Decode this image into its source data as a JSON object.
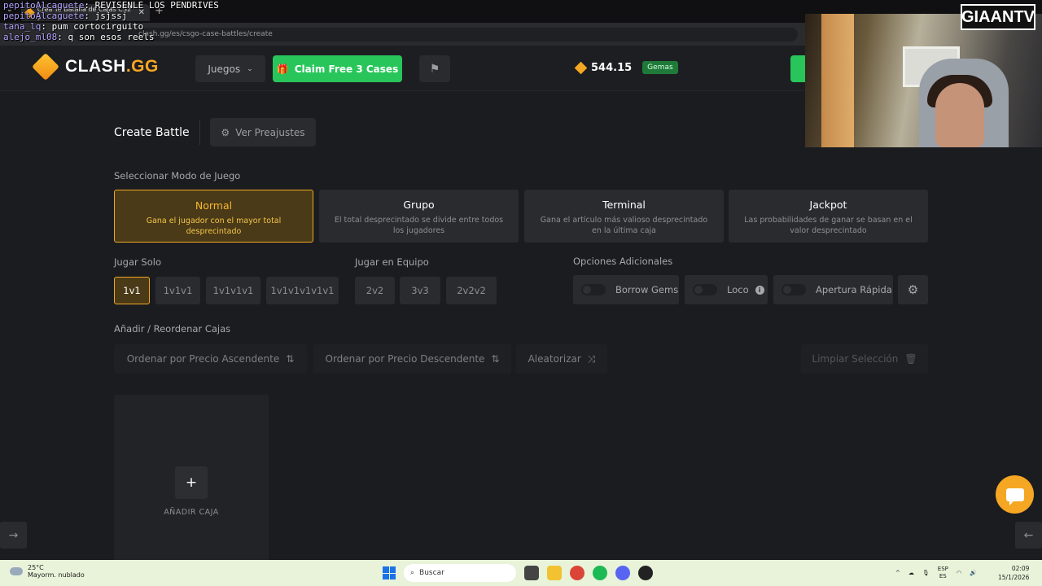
{
  "browser": {
    "tab_title": "Crea Tu Batalla de Cajas CS2 y",
    "url": "clash.gg/es/csgo-case-battles/create"
  },
  "chat": [
    {
      "user": "pepitoAlcaguete",
      "message": "REVISENLE LOS PENDRIVES"
    },
    {
      "user": "pepitoAlcaguete",
      "message": "jsjssj"
    },
    {
      "user": "tana_lq",
      "message": "pum cortocirguito"
    },
    {
      "user": "alejo_ml08",
      "message": "q son esos reels"
    }
  ],
  "header": {
    "logo_main": "CLASH",
    "logo_suffix": ".GG",
    "juegos_label": "Juegos",
    "claim_label": "Claim Free 3 Cases",
    "balance": "544.15",
    "balance_tag": "Gemas"
  },
  "stream": {
    "badge": "GIAANTV"
  },
  "page": {
    "title": "Create Battle",
    "presets_label": "Ver Preajustes",
    "mode_section": "Seleccionar Modo de Juego",
    "modes": [
      {
        "name": "Normal",
        "desc": "Gana el jugador con el mayor total desprecintado",
        "active": true
      },
      {
        "name": "Grupo",
        "desc": "El total desprecintado se divide entre todos los jugadores",
        "active": false
      },
      {
        "name": "Terminal",
        "desc": "Gana el artículo más valioso desprecintado en la última caja",
        "active": false
      },
      {
        "name": "Jackpot",
        "desc": "Las probabilidades de ganar se basan en el valor desprecintado",
        "active": false
      }
    ],
    "solo_section": "Jugar Solo",
    "solo_options": [
      "1v1",
      "1v1v1",
      "1v1v1v1",
      "1v1v1v1v1v1"
    ],
    "team_section": "Jugar en Equipo",
    "team_options": [
      "2v2",
      "3v3",
      "2v2v2"
    ],
    "extra_section": "Opciones Adicionales",
    "extra_options": [
      "Borrow Gems",
      "Loco",
      "Apertura Rápida"
    ],
    "boxes_section": "Añadir / Reordenar Cajas",
    "sort_asc": "Ordenar por Precio Ascendente",
    "sort_desc": "Ordenar por Precio Descendente",
    "randomize": "Aleatorizar",
    "clear": "Limpiar Selección",
    "add_box_label": "AÑADIR CAJA"
  },
  "taskbar": {
    "temp": "25°C",
    "weather": "Mayorm. nublado",
    "search": "Buscar",
    "lang1": "ESP",
    "lang2": "ES",
    "time": "02:09",
    "date": "15/1/2026"
  },
  "colors": {
    "accent": "#f5a623",
    "green": "#28c65a",
    "bg": "#1b1c1f"
  }
}
